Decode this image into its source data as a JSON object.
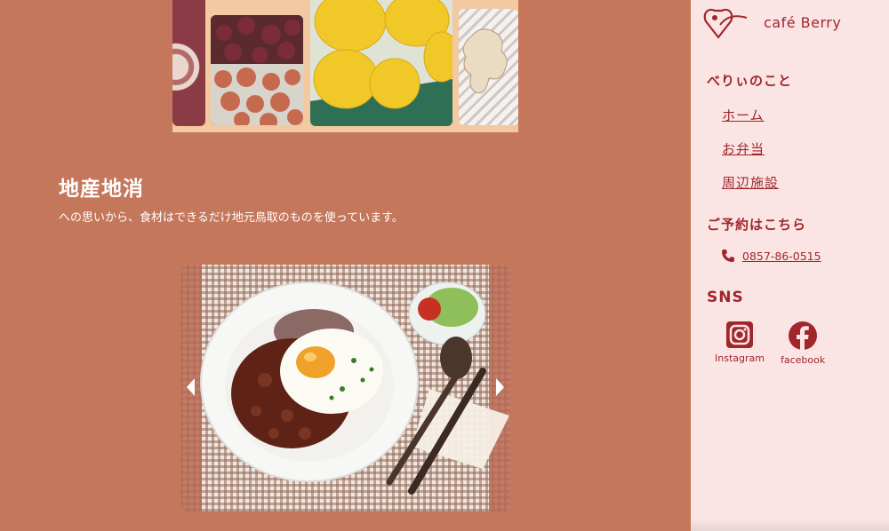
{
  "brand": {
    "name": "café Berry"
  },
  "intro": {
    "title": "地産地消",
    "subtitle": "への思いから、食材はできるだけ地元鳥取のものを使っています。"
  },
  "sidebar": {
    "about_heading": "べりぃのこと",
    "nav": [
      {
        "label": "ホーム"
      },
      {
        "label": "お弁当"
      },
      {
        "label": "周辺施設"
      }
    ],
    "reserve_heading": "ご予約はこちら",
    "phone": "0857-86-0515",
    "sns_heading": "SNS",
    "sns_links": [
      {
        "label": "Instagram",
        "icon": "instagram-icon"
      },
      {
        "label": "facebook",
        "icon": "facebook-icon"
      }
    ]
  },
  "colors": {
    "main_bg": "#c5775b",
    "sidebar_bg": "#fbe5e4",
    "accent": "#a0262b"
  }
}
